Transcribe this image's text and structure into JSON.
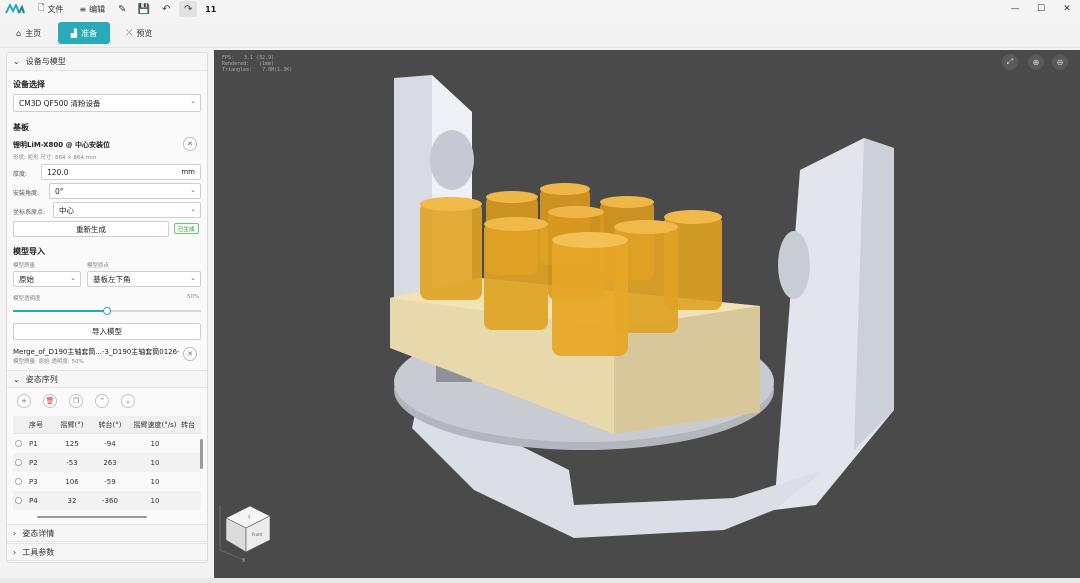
{
  "menu": {
    "file": "文件",
    "edit": "编辑",
    "counter": "11"
  },
  "tabs": [
    {
      "label": "主页"
    },
    {
      "label": "准备"
    },
    {
      "label": "预览"
    }
  ],
  "panel": {
    "section_device_model": "设备与模型",
    "device_select_label": "设备选择",
    "device_value": "CM3D QF500 清粉设备",
    "substrate_label": "基板",
    "substrate_name": "锂明LiM-X800 @ 中心安装位",
    "substrate_desc": "形状: 矩形  尺寸: 864 × 864 mm",
    "thickness_label": "厚度:",
    "thickness_value": "120.0",
    "thickness_unit": "mm",
    "angle_label": "安装角度:",
    "angle_value": "0°",
    "origin_label": "坐标系原点:",
    "origin_value": "中心",
    "regen_label": "重新生成",
    "generated_badge": "已生成",
    "import_label": "模型导入",
    "quality_label": "模型质量",
    "quality_value": "原始",
    "model_origin_label": "模型原点",
    "model_origin_value": "基板左下角",
    "opacity_label": "模型透明度",
    "opacity_value": "50%",
    "opacity_level": 0.5,
    "import_button": "导入模型",
    "model_file": "Merge_of_D190主轴套筒...-3_D190主轴套筒0126-3",
    "model_file_desc": "模型质量: 原始  透明度: 50%",
    "section_pose_seq": "姿态序列",
    "section_pose_detail": "姿态详情",
    "section_tool_params": "工具参数",
    "table": {
      "headers": [
        "序号",
        "摇臂(°)",
        "转台(°)",
        "摇臂速度(°/s)",
        "转台"
      ],
      "rows": [
        [
          "P1",
          "125",
          "-94",
          "10"
        ],
        [
          "P2",
          "-53",
          "263",
          "10"
        ],
        [
          "P3",
          "106",
          "-59",
          "10"
        ],
        [
          "P4",
          "32",
          "-360",
          "10"
        ]
      ]
    }
  },
  "viewport": {
    "stats": [
      {
        "k": "FPS:",
        "v": "3.1 (32.9)"
      },
      {
        "k": "Rendered:",
        "v": "(1mm)"
      },
      {
        "k": "Triangles:",
        "v": "7.0M(1.3K)"
      }
    ],
    "cube_labels": {
      "top": "Y",
      "front": "Front",
      "axis_x": "X"
    }
  },
  "colors": {
    "accent": "#29aab8",
    "viewport_bg": "#4a4a4a",
    "part": "#e5a021",
    "base": "#f2e2b6"
  }
}
